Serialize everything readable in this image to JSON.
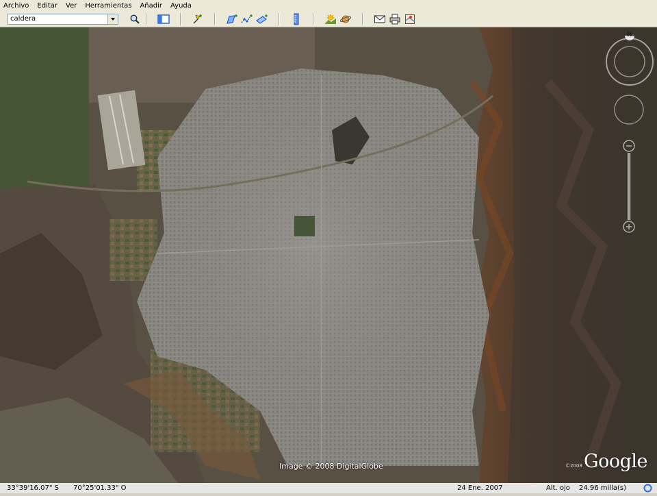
{
  "menu": {
    "items": [
      "Archivo",
      "Editar",
      "Ver",
      "Herramientas",
      "Añadir",
      "Ayuda"
    ]
  },
  "search": {
    "value": "caldera"
  },
  "toolbar": {
    "icons": [
      "search-icon",
      "sidebar-toggle-icon",
      "placemark-icon",
      "polygon-icon",
      "path-icon",
      "image-overlay-icon",
      "ruler-icon",
      "sun-icon",
      "planet-icon",
      "email-icon",
      "print-icon",
      "maps-icon"
    ]
  },
  "map": {
    "copyright": "Image © 2008 DigitalGlobe",
    "logo": "Google",
    "logo_year": "©2008",
    "compass_north": "N"
  },
  "status": {
    "latitude": "33°39'16.07\" S",
    "longitude": "70°25'01.33\" O",
    "imagery_date": "24 Ene. 2007",
    "altitude_label": "Alt. ojo",
    "altitude_value": "24.96 milla(s)"
  },
  "colors": {
    "menu_bg": "#ece9d8",
    "accent_blue": "#1e5bd6",
    "status_bg": "#e6e6e6"
  }
}
